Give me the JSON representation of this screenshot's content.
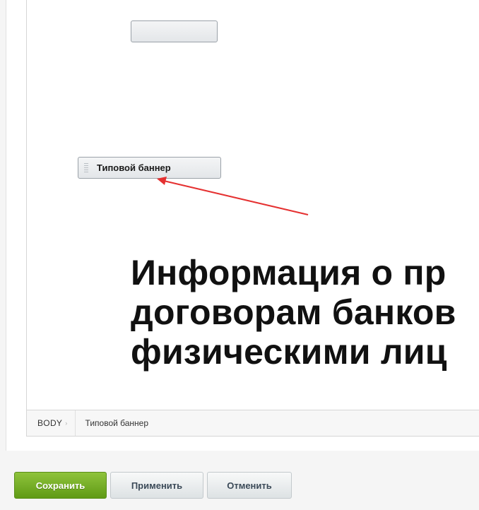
{
  "editor": {
    "banner_block_label": "Типовой баннер",
    "heading_lines": [
      "Информация о пр",
      "договорам банков",
      "физическими лиц"
    ]
  },
  "status_bar": {
    "crumb_body": "BODY",
    "crumb_separator": "›",
    "crumb_current": "Типовой баннер"
  },
  "actions": {
    "save_label": "Сохранить",
    "apply_label": "Применить",
    "cancel_label": "Отменить"
  },
  "colors": {
    "save_button": "#6fa820",
    "annotation_arrow": "#e53131"
  }
}
